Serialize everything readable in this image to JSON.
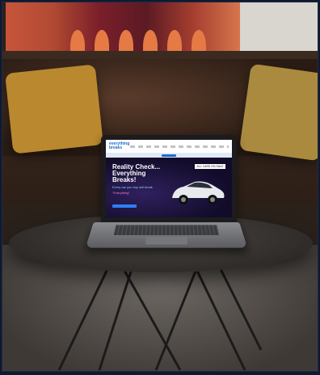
{
  "scene": {
    "description": "",
    "laptop_site": {
      "logo_text": "everything breaks",
      "hero_title": "Reality Check... Everything Breaks!",
      "tagline_1": "Every car you buy will break",
      "tagline_2": "\"Everything\"",
      "badge_text": "ALL CARS ON SALE"
    }
  },
  "colors": {
    "accent": "#1b6bd1",
    "hero_bg": "#120c2a",
    "pillow": "#b9882f"
  }
}
